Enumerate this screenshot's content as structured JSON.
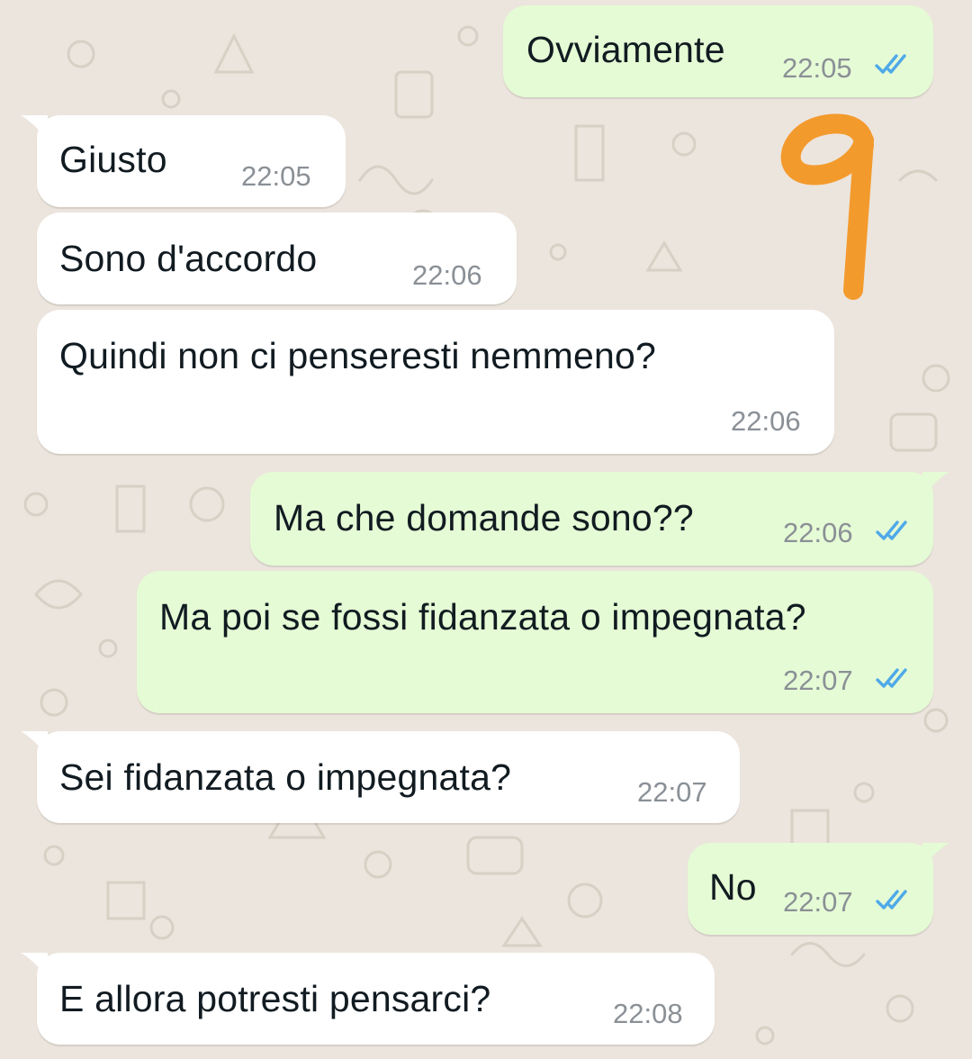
{
  "colors": {
    "chat_background": "#ece5dd",
    "incoming_bubble": "#ffffff",
    "outgoing_bubble": "#e5fbd5",
    "read_ticks": "#4fa9e8",
    "annotation": "#f39a2d"
  },
  "annotation": {
    "text": "9"
  },
  "messages": [
    {
      "direction": "outgoing",
      "text": "Ovviamente",
      "time": "22:05",
      "status_icon": "double-check-read-icon"
    },
    {
      "direction": "incoming",
      "text": "Giusto",
      "time": "22:05"
    },
    {
      "direction": "incoming",
      "text": "Sono d'accordo",
      "time": "22:06"
    },
    {
      "direction": "incoming",
      "text": "Quindi non ci penseresti nemmeno?",
      "time": "22:06"
    },
    {
      "direction": "outgoing",
      "text": "Ma che domande sono??",
      "time": "22:06",
      "status_icon": "double-check-read-icon"
    },
    {
      "direction": "outgoing",
      "text": "Ma poi se fossi fidanzata o impegnata?",
      "time": "22:07",
      "status_icon": "double-check-read-icon"
    },
    {
      "direction": "incoming",
      "text": "Sei fidanzata o impegnata?",
      "time": "22:07"
    },
    {
      "direction": "outgoing",
      "text": "No",
      "time": "22:07",
      "status_icon": "double-check-read-icon"
    },
    {
      "direction": "incoming",
      "text": "E allora potresti pensarci?",
      "time": "22:08"
    }
  ]
}
